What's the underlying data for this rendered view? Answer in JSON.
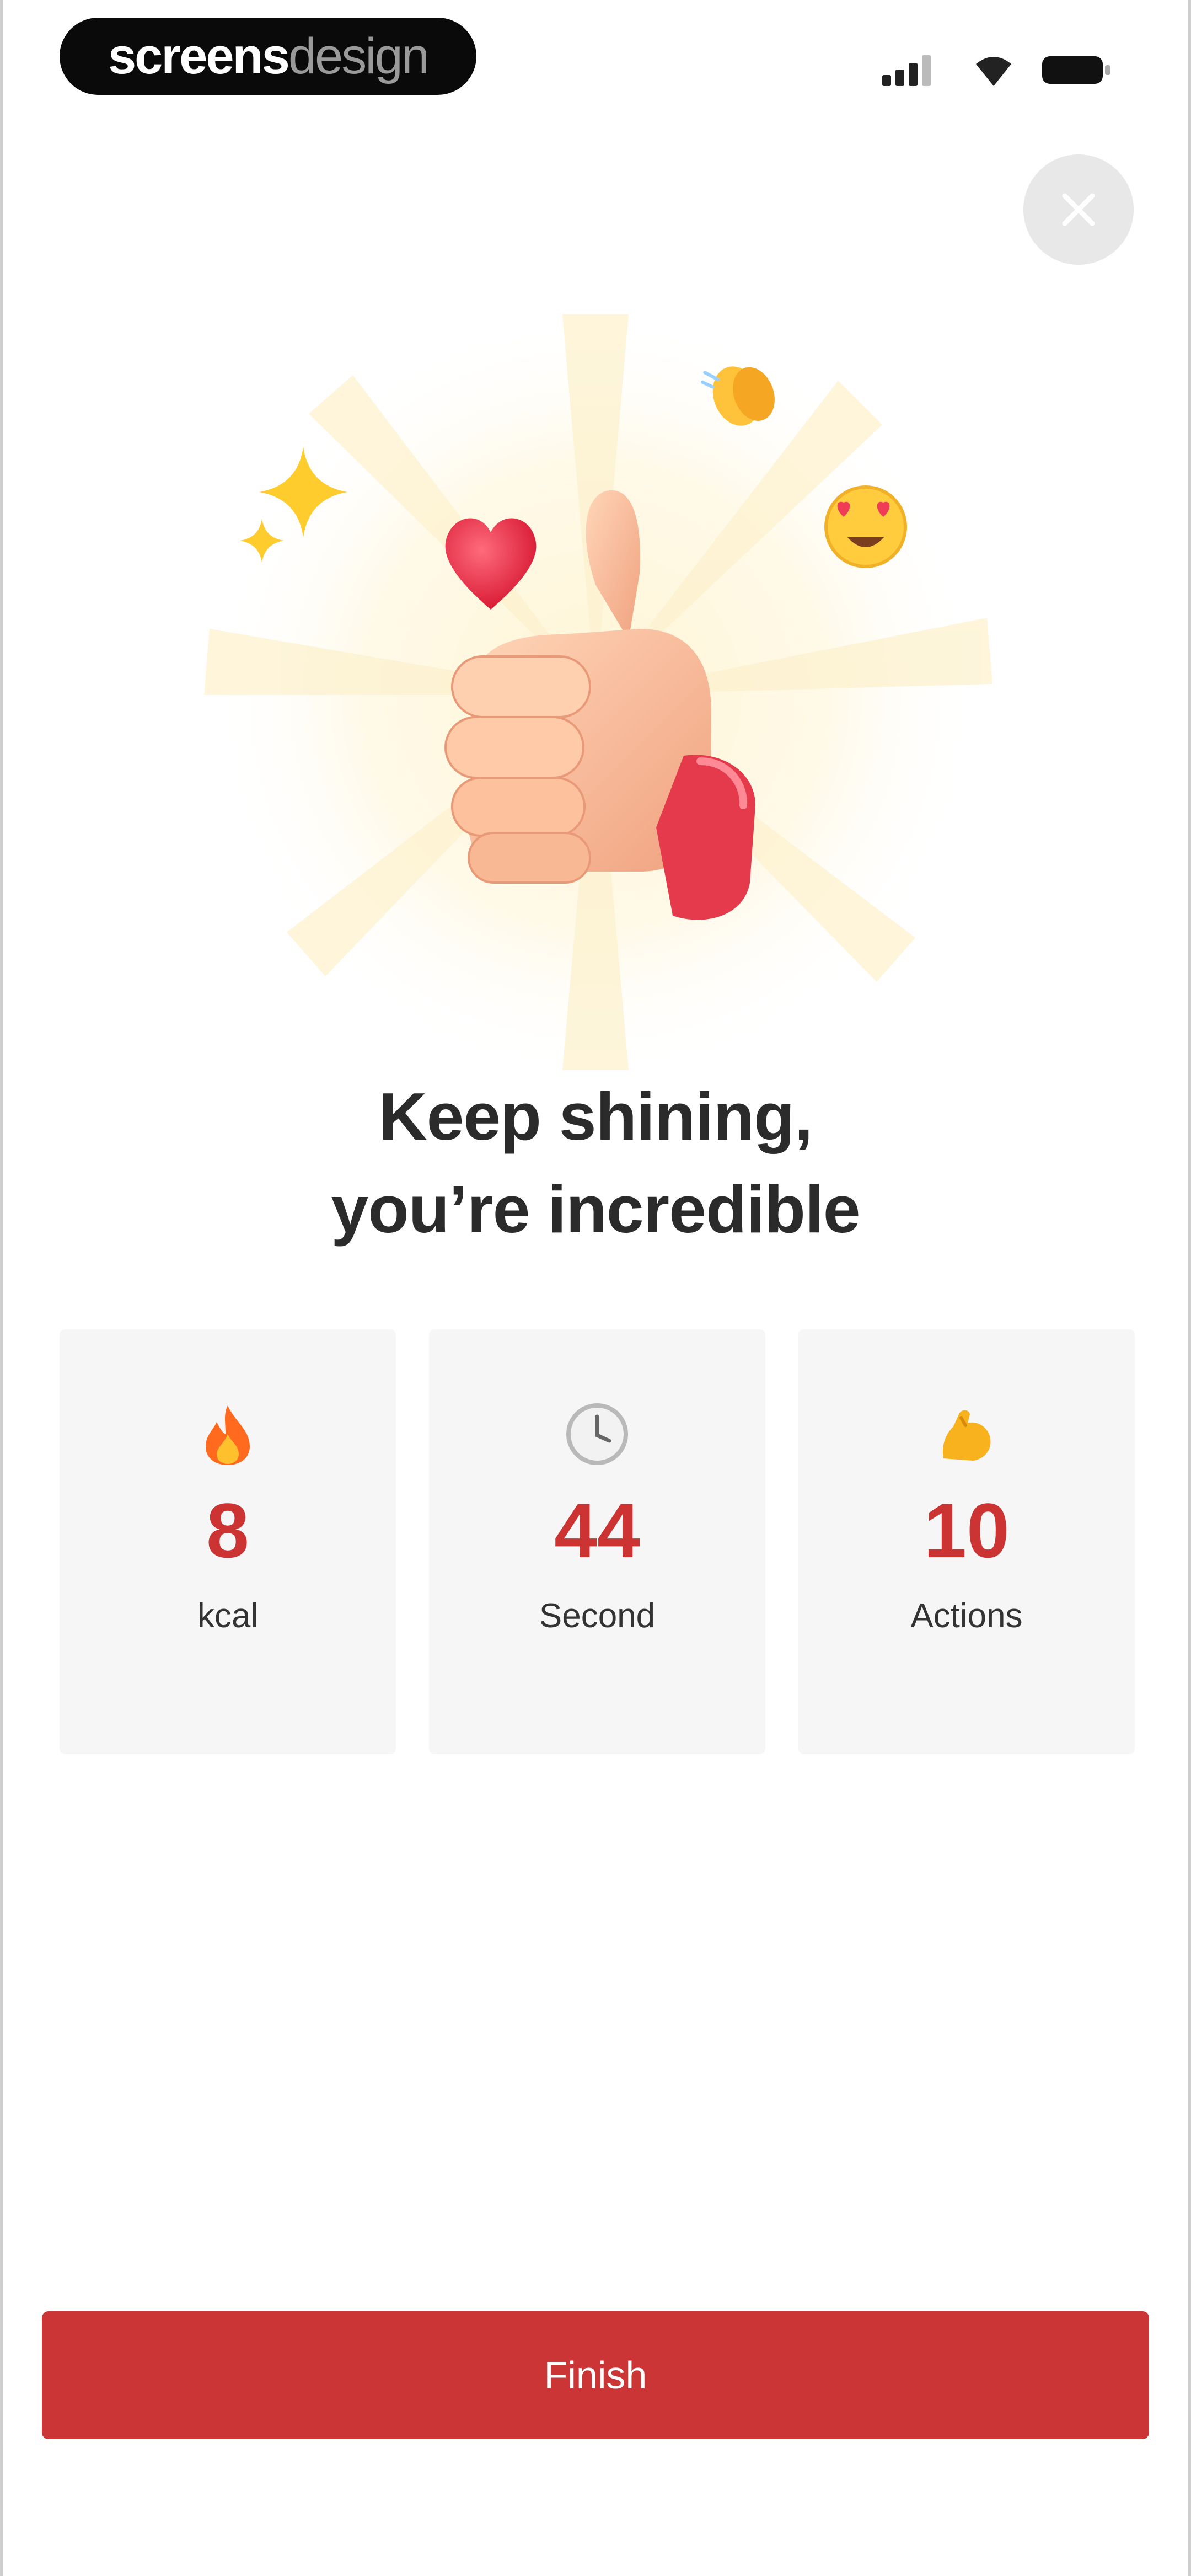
{
  "status_bar": {
    "brand_bold": "screens",
    "brand_light": "design"
  },
  "hero": {
    "illustration": "thumbs-up-celebration",
    "emojis": [
      "sparkles-icon",
      "heart-icon",
      "clapping-hands-icon",
      "heart-eyes-icon"
    ]
  },
  "headline": {
    "line1": "Keep shining,",
    "line2": "you’re incredible"
  },
  "stats": [
    {
      "icon": "fire-icon",
      "value": "8",
      "label": "kcal"
    },
    {
      "icon": "clock-icon",
      "value": "44",
      "label": "Second"
    },
    {
      "icon": "flexed-biceps-icon",
      "value": "10",
      "label": "Actions"
    }
  ],
  "finish_label": "Finish",
  "colors": {
    "accent": "#cc3535",
    "value_text": "#cc3333",
    "card_bg": "#f6f6f6",
    "close_bg": "#e8e8e8"
  }
}
